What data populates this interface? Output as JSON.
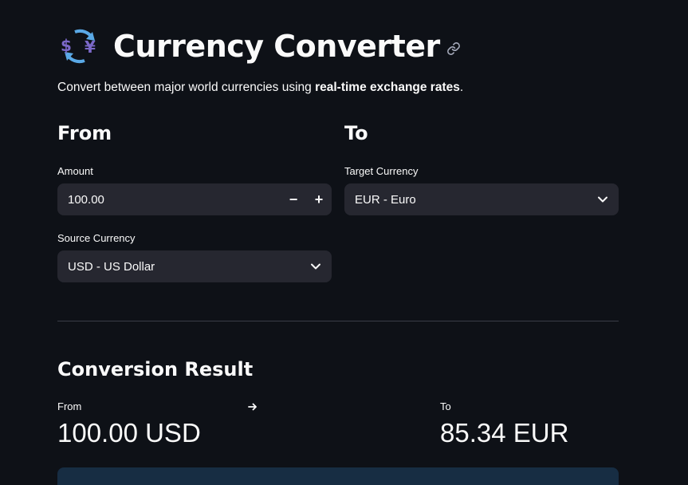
{
  "header": {
    "title": "Currency Converter",
    "title_icon": "currency-exchange-emoji",
    "subtitle_prefix": "Convert between major world currencies using ",
    "subtitle_bold": "real-time exchange rates",
    "subtitle_suffix": "."
  },
  "from_section": {
    "heading": "From",
    "amount_label": "Amount",
    "amount_value": "100.00",
    "decrement_label": "−",
    "increment_label": "+",
    "source_label": "Source Currency",
    "source_value": "USD - US Dollar"
  },
  "to_section": {
    "heading": "To",
    "target_label": "Target Currency",
    "target_value": "EUR - Euro"
  },
  "result": {
    "heading": "Conversion Result",
    "from_label": "From",
    "from_value": "100.00 USD",
    "to_label": "To",
    "to_value": "85.34 EUR"
  },
  "colors": {
    "background": "#0e1117",
    "input_background": "#262730",
    "text": "#fafafa",
    "info_background": "#172d43",
    "icon_blue": "#5aa9e6",
    "icon_purple": "#7b68c8"
  }
}
